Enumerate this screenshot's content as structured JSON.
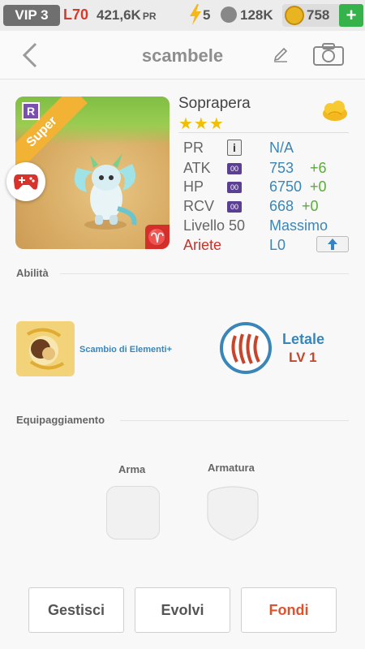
{
  "topbar": {
    "vip": "VIP 3",
    "level": "L70",
    "pr_value": "421,6K",
    "pr_unit": "PR",
    "energy": "5",
    "paws": "128K",
    "coins": "758",
    "add": "+"
  },
  "header": {
    "title": "scambele",
    "icons": [
      "back-chevron-icon",
      "pencil-icon",
      "camera-icon"
    ]
  },
  "monster": {
    "badge": "R",
    "ribbon": "Super",
    "element_sign": "♈",
    "name": "Soprapera",
    "stars": "★★★",
    "stats": {
      "pr_label": "PR",
      "pr_value": "N/A",
      "atk_label": "ATK",
      "atk_value": "753",
      "atk_bonus": "+6",
      "hp_label": "HP",
      "hp_value": "6750",
      "hp_bonus": "+0",
      "rcv_label": "RCV",
      "rcv_value": "668",
      "rcv_bonus": "+0",
      "chip": "00",
      "info": "i",
      "level_label": "Livello 50",
      "level_value": "Massimo",
      "sign_label": "Ariete",
      "sign_value": "L0"
    }
  },
  "abilities": {
    "header": "Abilità",
    "skill_name": "Scambio di Elementi+",
    "passive_name": "Letale",
    "passive_level": "LV 1"
  },
  "equipment": {
    "header": "Equipaggiamento",
    "weapon_label": "Arma",
    "armor_label": "Armatura"
  },
  "actions": {
    "manage": "Gestisci",
    "evolve": "Evolvi",
    "merge": "Fondi"
  },
  "colors": {
    "accent_blue": "#3b86b8",
    "bonus_green": "#5aab3c",
    "red": "#d4302b",
    "merge_orange": "#e0522a"
  }
}
